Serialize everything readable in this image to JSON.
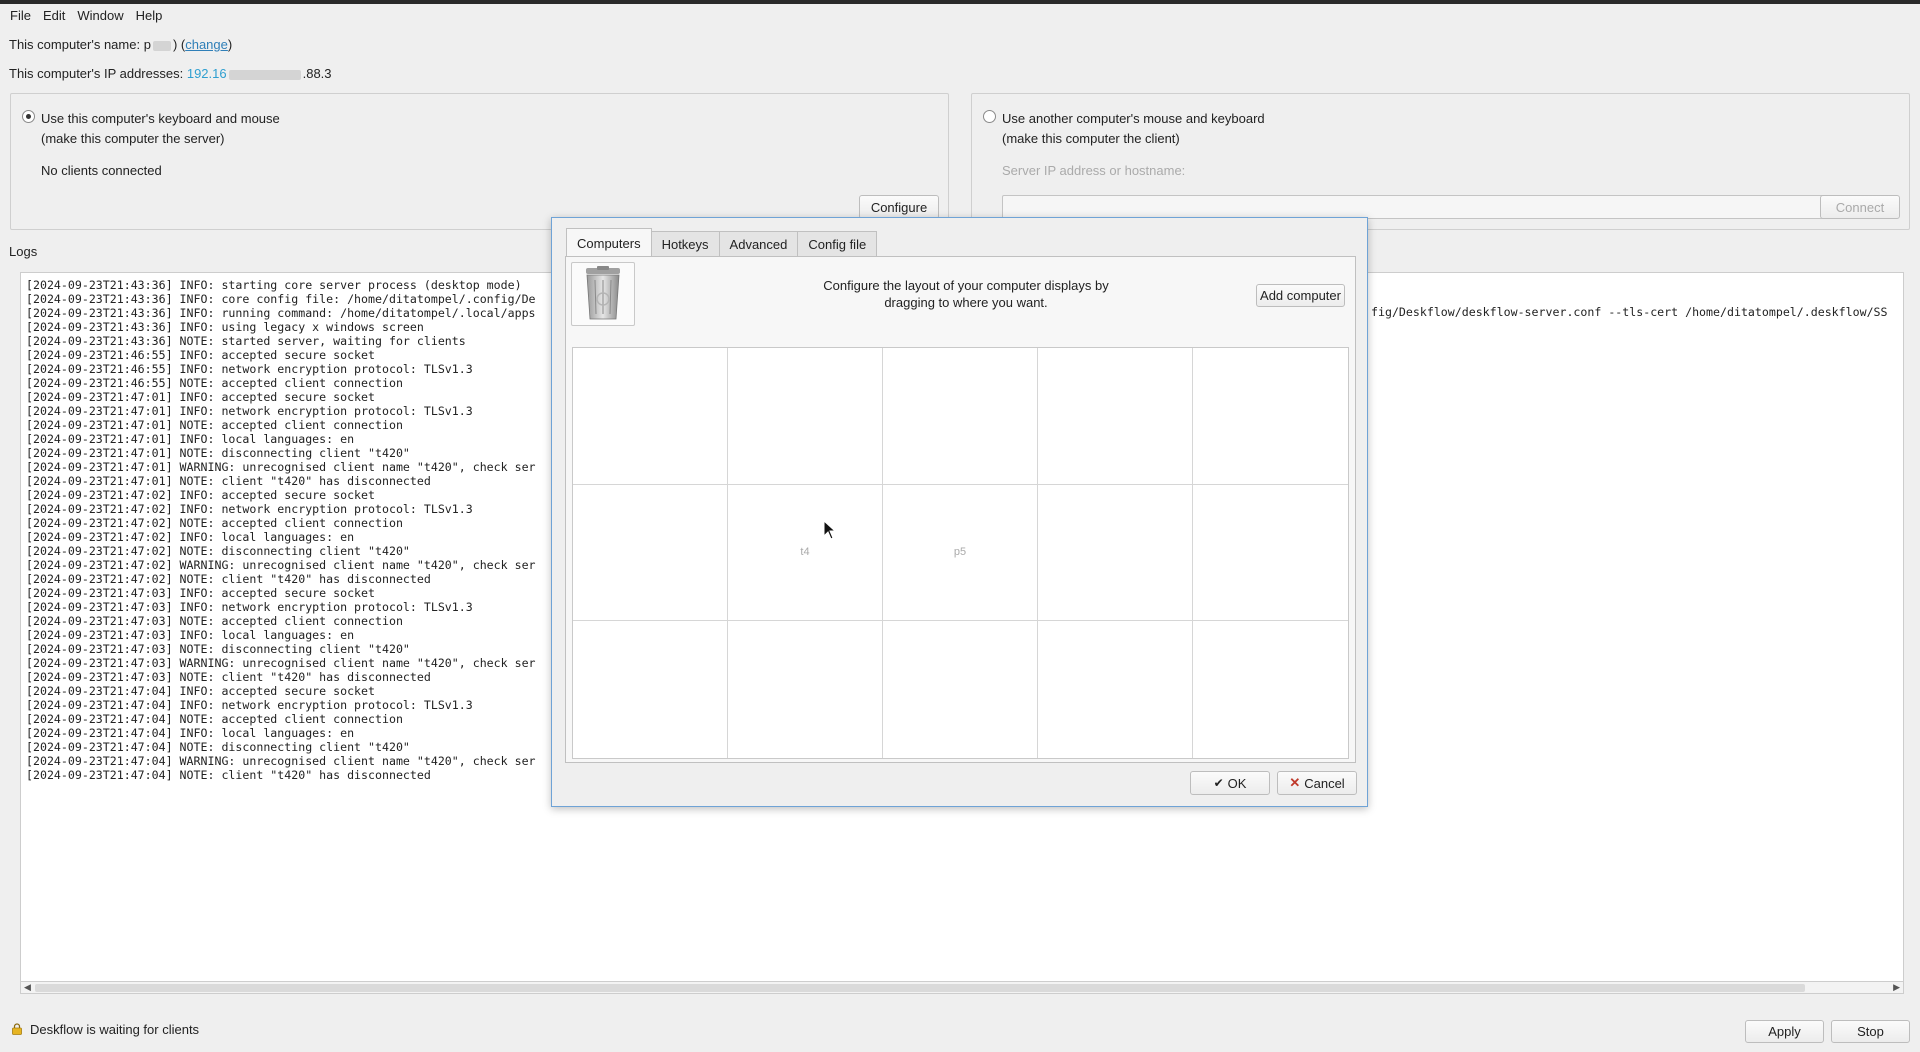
{
  "menu": [
    "File",
    "Edit",
    "Window",
    "Help"
  ],
  "computer_name": {
    "prefix": "This computer's name: p",
    "suffix": ") (",
    "change_link": "change",
    "close": ")"
  },
  "ip_addresses": {
    "label": "This computer's IP addresses:",
    "value_start": "192.16",
    "value_end": ".88.3"
  },
  "server": {
    "radio_label_1": "Use this computer's keyboard and mouse",
    "radio_label_2": "(make this computer the server)",
    "status": "No clients connected",
    "configure_button": "Configure"
  },
  "client": {
    "radio_label_1": "Use another computer's mouse and keyboard",
    "radio_label_2": "(make this computer the client)",
    "server_ip_label": "Server IP address or hostname:",
    "connect_button": "Connect"
  },
  "logs": {
    "label": "Logs",
    "lines": [
      "[2024-09-23T21:43:36] INFO: starting core server process (desktop mode)",
      "[2024-09-23T21:43:36] INFO: core config file: /home/ditatompel/.config/De",
      "[2024-09-23T21:43:36] INFO: running command: /home/ditatompel/.local/apps",
      "[2024-09-23T21:43:36] INFO: using legacy x windows screen",
      "[2024-09-23T21:43:36] NOTE: started server, waiting for clients",
      "[2024-09-23T21:46:55] INFO: accepted secure socket",
      "[2024-09-23T21:46:55] INFO: network encryption protocol: TLSv1.3",
      "[2024-09-23T21:46:55] NOTE: accepted client connection",
      "[2024-09-23T21:47:01] INFO: accepted secure socket",
      "[2024-09-23T21:47:01] INFO: network encryption protocol: TLSv1.3",
      "[2024-09-23T21:47:01] NOTE: accepted client connection",
      "[2024-09-23T21:47:01] INFO: local languages: en",
      "[2024-09-23T21:47:01] NOTE: disconnecting client \"t420\"",
      "[2024-09-23T21:47:01] WARNING: unrecognised client name \"t420\", check ser",
      "[2024-09-23T21:47:01] NOTE: client \"t420\" has disconnected",
      "[2024-09-23T21:47:02] INFO: accepted secure socket",
      "[2024-09-23T21:47:02] INFO: network encryption protocol: TLSv1.3",
      "[2024-09-23T21:47:02] NOTE: accepted client connection",
      "[2024-09-23T21:47:02] INFO: local languages: en",
      "[2024-09-23T21:47:02] NOTE: disconnecting client \"t420\"",
      "[2024-09-23T21:47:02] WARNING: unrecognised client name \"t420\", check ser",
      "[2024-09-23T21:47:02] NOTE: client \"t420\" has disconnected",
      "[2024-09-23T21:47:03] INFO: accepted secure socket",
      "[2024-09-23T21:47:03] INFO: network encryption protocol: TLSv1.3",
      "[2024-09-23T21:47:03] NOTE: accepted client connection",
      "[2024-09-23T21:47:03] INFO: local languages: en",
      "[2024-09-23T21:47:03] NOTE: disconnecting client \"t420\"",
      "[2024-09-23T21:47:03] WARNING: unrecognised client name \"t420\", check ser",
      "[2024-09-23T21:47:03] NOTE: client \"t420\" has disconnected",
      "[2024-09-23T21:47:04] INFO: accepted secure socket",
      "[2024-09-23T21:47:04] INFO: network encryption protocol: TLSv1.3",
      "[2024-09-23T21:47:04] NOTE: accepted client connection",
      "[2024-09-23T21:47:04] INFO: local languages: en",
      "[2024-09-23T21:47:04] NOTE: disconnecting client \"t420\"",
      "[2024-09-23T21:47:04] WARNING: unrecognised client name \"t420\", check ser",
      "[2024-09-23T21:47:04] NOTE: client \"t420\" has disconnected"
    ],
    "right_fragment": "fig/Deskflow/deskflow-server.conf --tls-cert /home/ditatompel/.deskflow/SS"
  },
  "status": {
    "text": "Deskflow is waiting for clients",
    "apply_button": "Apply",
    "stop_button": "Stop"
  },
  "dialog": {
    "tabs": [
      "Computers",
      "Hotkeys",
      "Advanced",
      "Config file"
    ],
    "active_tab": "Computers",
    "instructions_line1": "Configure the layout of your computer displays by",
    "instructions_line2": "dragging to where you want.",
    "add_computer_button": "Add computer",
    "grid_cells": [
      "",
      "",
      "",
      "",
      "",
      "",
      "t4",
      "p5",
      "",
      "",
      "",
      "",
      "",
      "",
      ""
    ],
    "ok_button": "OK",
    "cancel_button": "Cancel"
  },
  "colors": {
    "accent": "#2f7fb8",
    "dialog_border": "#6fa3d6",
    "cancel_icon": "#c0392b"
  }
}
